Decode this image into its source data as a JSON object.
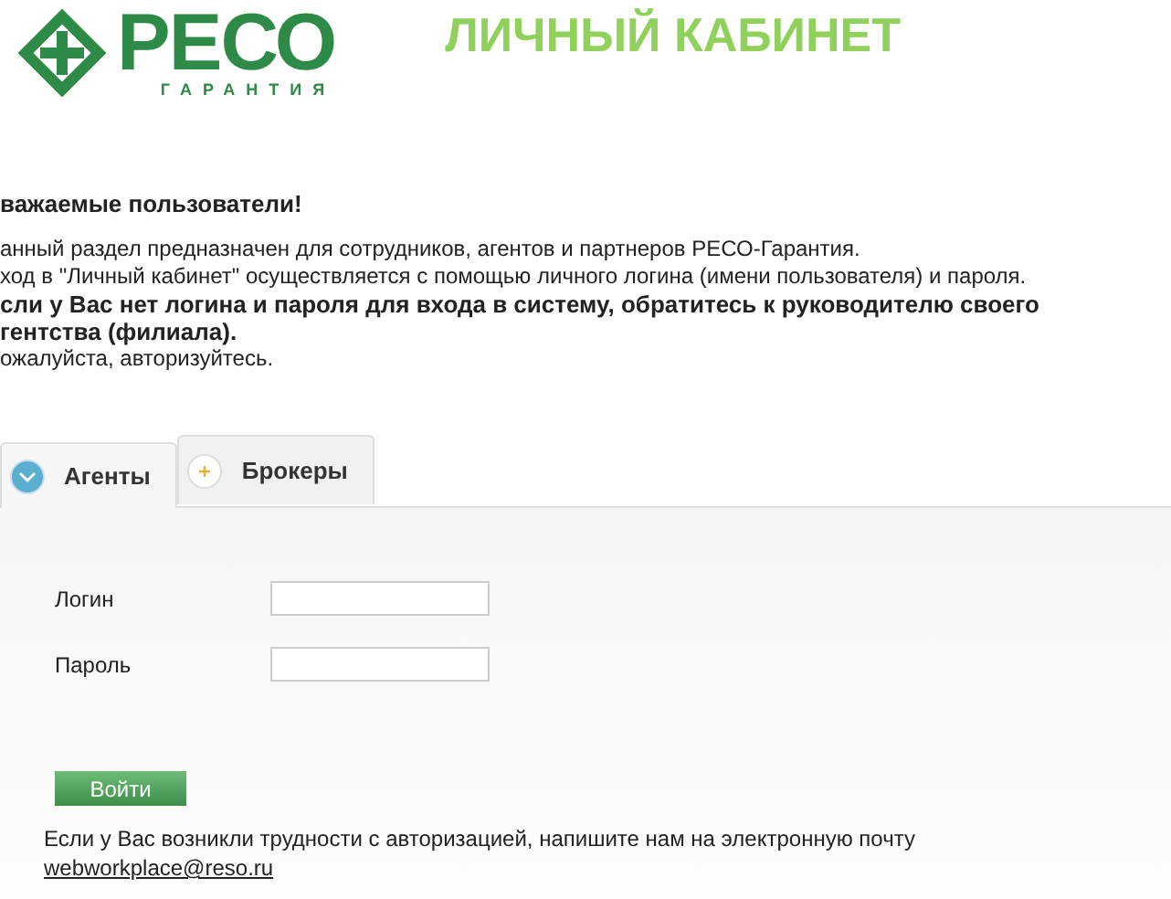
{
  "header": {
    "logo_text": "РЕСО",
    "logo_subtext": "ГАРАНТИЯ",
    "title": "ЛИЧНЫЙ КАБИНЕТ"
  },
  "intro": [
    {
      "text": "важаемые пользователи!",
      "bold": true
    },
    {
      "text": "анный раздел предназначен для сотрудников, агентов и партнеров РЕСО-Гарантия.",
      "bold": false
    },
    {
      "text": "ход в \"Личный кабинет\" осуществляется с помощью личного логина (имени пользователя) и пароля.",
      "bold": false
    },
    {
      "text": "сли у Вас нет логина и пароля для входа в систему, обратитесь к руководителю своего",
      "bold": true
    },
    {
      "text": "гентства (филиала).",
      "bold": true
    },
    {
      "text": "ожалуйста, авторизуйтесь.",
      "bold": false
    }
  ],
  "tabs": [
    {
      "label": "Агенты",
      "selected": true
    },
    {
      "label": "Брокеры",
      "selected": false
    }
  ],
  "form": {
    "fields": [
      {
        "label": "Логин"
      },
      {
        "label": "Пароль"
      }
    ],
    "submit": "Войти",
    "help_text": "Если у Вас возникли трудности с авторизацией, напишите нам на электронную почту",
    "help_link": "webworkplace@reso.ru"
  }
}
